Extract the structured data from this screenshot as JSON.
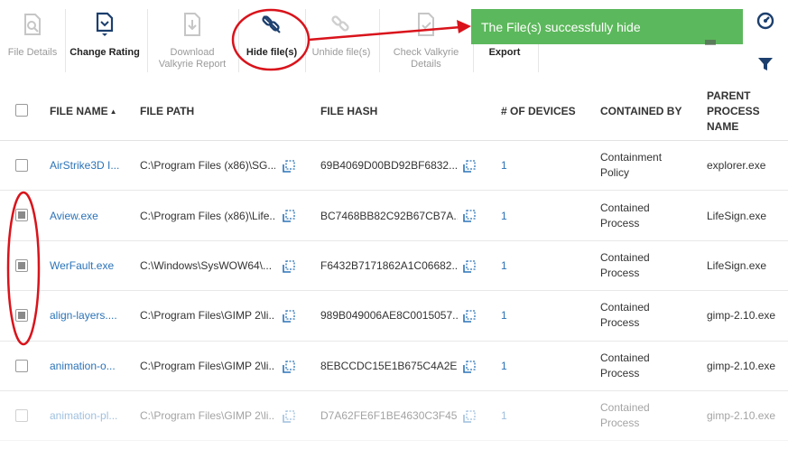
{
  "toolbar": {
    "buttons": [
      {
        "label": "File Details",
        "state": "disabled",
        "icon": "file-search-icon"
      },
      {
        "label": "Change Rating",
        "state": "active",
        "icon": "rating-icon"
      },
      {
        "label": "Download\nValkyrie Report",
        "state": "disabled",
        "icon": "download-report-icon"
      },
      {
        "label": "Hide file(s)",
        "state": "active",
        "icon": "hide-link-icon"
      },
      {
        "label": "Unhide file(s)",
        "state": "disabled",
        "icon": "unhide-link-icon"
      },
      {
        "label": "Check Valkyrie\nDetails",
        "state": "disabled",
        "icon": "check-details-icon"
      },
      {
        "label": "Export",
        "state": "active",
        "icon": "export-icon"
      }
    ]
  },
  "toast": {
    "message": "The File(s) successfully hide",
    "color": "#5cb85c"
  },
  "table": {
    "columns": [
      "FILE NAME",
      "FILE PATH",
      "FILE HASH",
      "# OF DEVICES",
      "CONTAINED BY",
      "PARENT\nPROCESS\nNAME"
    ],
    "sort_indicator": "▲",
    "rows": [
      {
        "checked": false,
        "name": "AirStrike3D I...",
        "path": "C:\\Program Files (x86)\\SG...",
        "hash": "69B4069D00BD92BF6832...",
        "devices": "1",
        "contained": "Containment\nPolicy",
        "parent": "explorer.exe"
      },
      {
        "checked": true,
        "name": "Aview.exe",
        "path": "C:\\Program Files (x86)\\Life...",
        "hash": "BC7468BB82C92B67CB7A...",
        "devices": "1",
        "contained": "Contained\nProcess",
        "parent": "LifeSign.exe"
      },
      {
        "checked": true,
        "name": "WerFault.exe",
        "path": "C:\\Windows\\SysWOW64\\...",
        "hash": "F6432B7171862A1C06682...",
        "devices": "1",
        "contained": "Contained\nProcess",
        "parent": "LifeSign.exe"
      },
      {
        "checked": true,
        "name": "align-layers....",
        "path": "C:\\Program Files\\GIMP 2\\li...",
        "hash": "989B049006AE8C0015057...",
        "devices": "1",
        "contained": "Contained\nProcess",
        "parent": "gimp-2.10.exe"
      },
      {
        "checked": false,
        "name": "animation-o...",
        "path": "C:\\Program Files\\GIMP 2\\li...",
        "hash": "8EBCCDC15E1B675C4A2E...",
        "devices": "1",
        "contained": "Contained\nProcess",
        "parent": "gimp-2.10.exe"
      },
      {
        "checked": false,
        "name": "animation-pl...",
        "path": "C:\\Program Files\\GIMP 2\\li...",
        "hash": "D7A62FE6F1BE4630C3F45...",
        "devices": "1",
        "contained": "Contained\nProcess",
        "parent": "gimp-2.10.exe"
      }
    ]
  },
  "colors": {
    "accent": "#2b73b8",
    "annotation": "#d9131b"
  }
}
